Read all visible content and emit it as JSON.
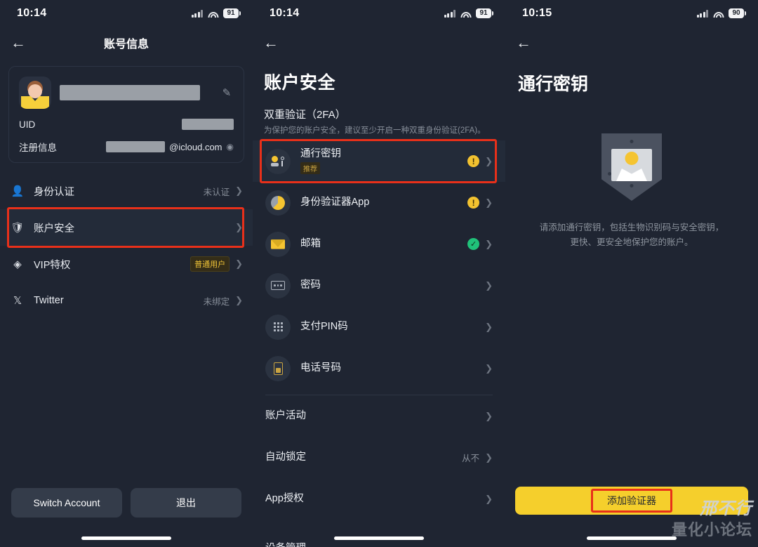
{
  "panel1": {
    "status": {
      "time": "10:14",
      "battery": "91",
      "signal_icon": "signal-bars-icon",
      "wifi_icon": "wifi-icon"
    },
    "nav": {
      "back_icon": "back-arrow-icon",
      "title": "账号信息"
    },
    "account_card": {
      "avatar_icon": "user-avatar",
      "name_redacted": "",
      "edit_icon": "edit-pencil-icon",
      "uid_label": "UID",
      "uid_value": "",
      "register_label": "注册信息",
      "register_value": "",
      "register_suffix": "@icloud.com",
      "eye_icon": "eye-icon"
    },
    "items": [
      {
        "icon": "person-icon",
        "label": "身份认证",
        "meta": "未认证",
        "badge": false,
        "highlighted": false
      },
      {
        "icon": "shield-icon",
        "label": "账户安全",
        "meta": "",
        "badge": false,
        "highlighted": true
      },
      {
        "icon": "diamond-icon",
        "label": "VIP特权",
        "meta": "普通用户",
        "badge": true,
        "highlighted": false
      },
      {
        "icon": "twitter-x-icon",
        "label": "Twitter",
        "meta": "未绑定",
        "badge": false,
        "highlighted": false
      }
    ],
    "buttons": {
      "switch_account": "Switch Account",
      "logout": "退出"
    }
  },
  "panel2": {
    "status": {
      "time": "10:14",
      "battery": "91"
    },
    "nav": {
      "back_icon": "back-arrow-icon"
    },
    "title": "账户安全",
    "section": {
      "heading": "双重验证（2FA）",
      "description": "为保护您的账户安全，建议至少开启一种双重身份验证(2FA)。"
    },
    "security_items": [
      {
        "icon": "passkey-icon",
        "label": "通行密钥",
        "tag": "推荐",
        "status": "warning",
        "highlighted": true
      },
      {
        "icon": "authenticator-icon",
        "label": "身份验证器App",
        "tag": "",
        "status": "warning",
        "highlighted": false
      },
      {
        "icon": "mail-icon",
        "label": "邮箱",
        "tag": "",
        "status": "ok",
        "highlighted": false
      },
      {
        "icon": "password-icon",
        "label": "密码",
        "tag": "",
        "status": "none",
        "highlighted": false
      },
      {
        "icon": "pin-pad-icon",
        "label": "支付PIN码",
        "tag": "",
        "status": "none",
        "highlighted": false
      },
      {
        "icon": "phone-icon",
        "label": "电话号码",
        "tag": "",
        "status": "none",
        "highlighted": false
      }
    ],
    "other_items": [
      {
        "label": "账户活动",
        "meta": ""
      },
      {
        "label": "自动锁定",
        "meta": "从不"
      },
      {
        "label": "App授权",
        "meta": ""
      }
    ],
    "cut_off_item": "设备管理"
  },
  "panel3": {
    "status": {
      "time": "10:15",
      "battery": "90"
    },
    "nav": {
      "back_icon": "back-arrow-icon"
    },
    "title": "通行密钥",
    "empty_state": {
      "illustration_icon": "passkey-shield-illustration",
      "description": "请添加通行密钥，包括生物识别码与安全密钥，更快、更安全地保护您的账户。"
    },
    "primary_button": "添加验证器",
    "watermark": {
      "line1": "邢不行",
      "line2": "量化小论坛"
    }
  },
  "colors": {
    "background": "#1f2532",
    "accent_yellow": "#f5cf2c",
    "highlight_red": "#e8301a",
    "status_ok": "#20c27a",
    "status_warn": "#f2c230"
  }
}
